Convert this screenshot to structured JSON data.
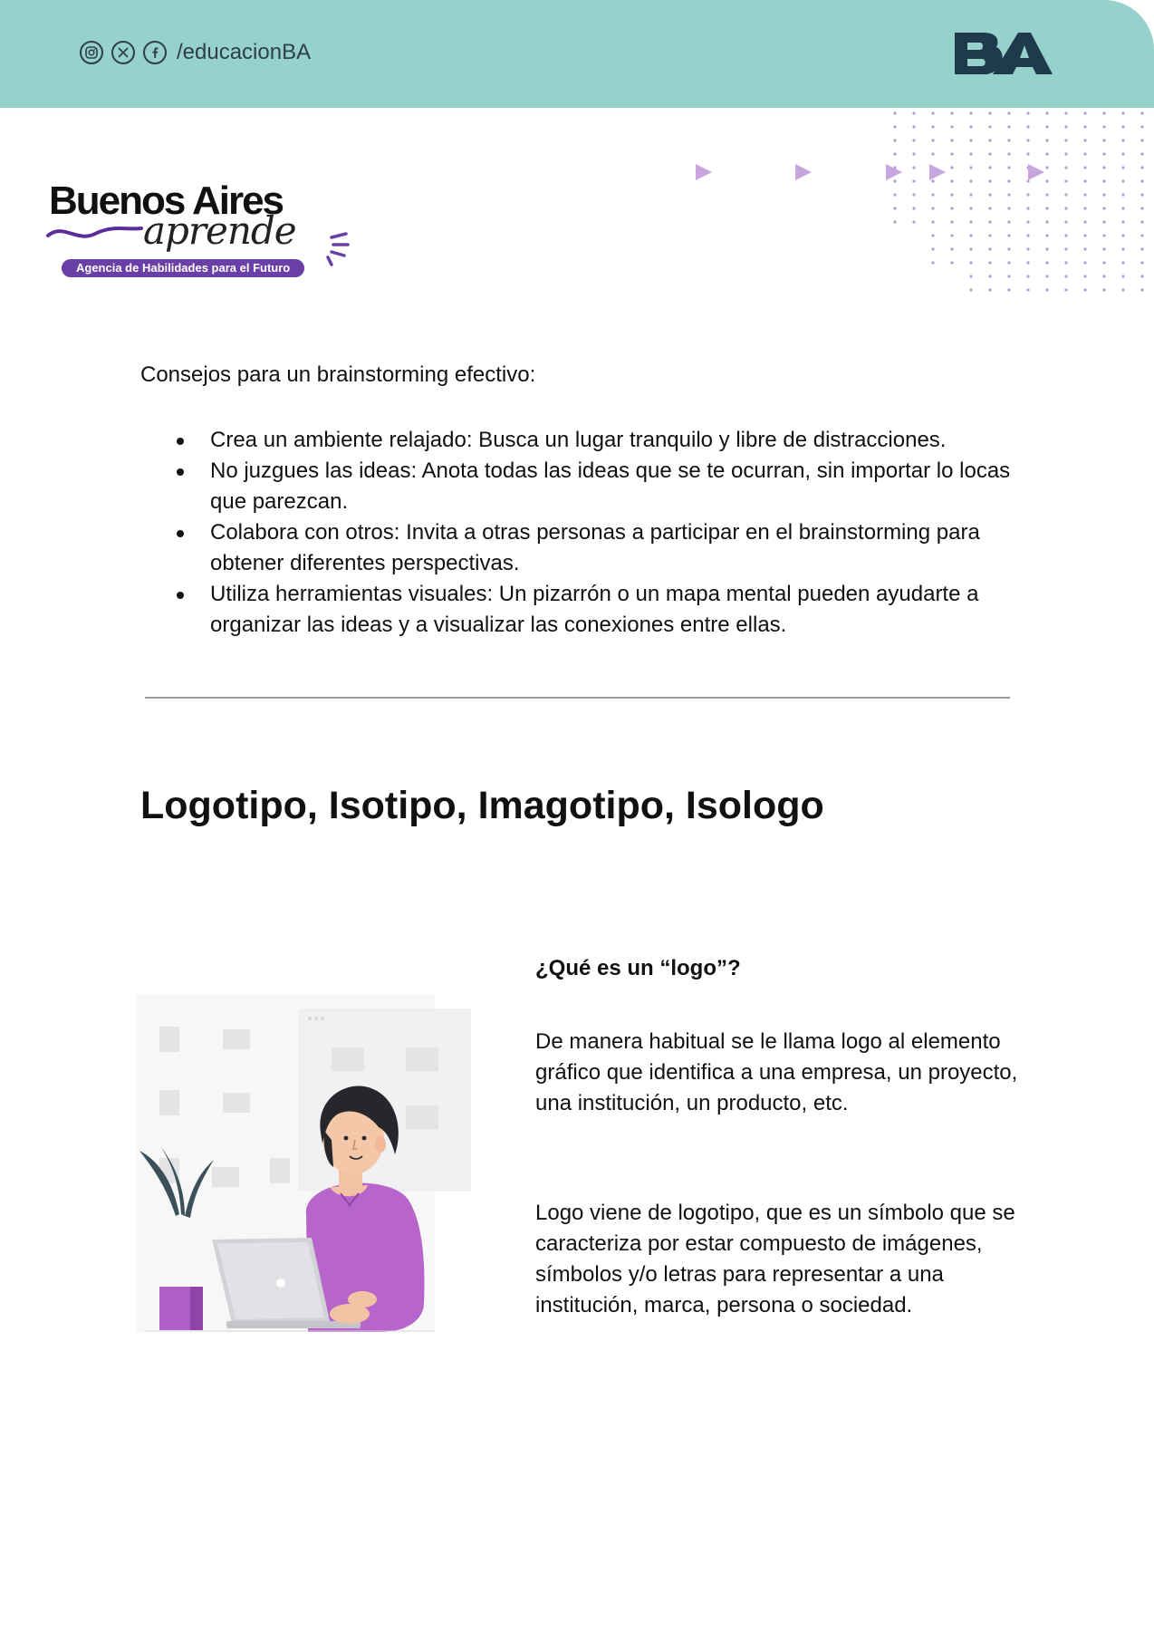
{
  "header": {
    "social_handle": "/educacionBA",
    "social_icons": [
      "instagram-icon",
      "x-icon",
      "facebook-icon"
    ],
    "logo_text": "BA",
    "band_color": "#96d2cb"
  },
  "brand": {
    "title": "Buenos Aires",
    "script": "aprende",
    "tagline": "Agencia de Habilidades para el Futuro",
    "accent_color": "#6a3fa6"
  },
  "tips": {
    "heading": "Consejos para un brainstorming efectivo:",
    "items": [
      "Crea un ambiente relajado: Busca un lugar tranquilo y libre de distracciones.",
      "No juzgues las ideas: Anota todas las ideas que se te ocurran, sin importar lo locas que parezcan.",
      "Colabora con otros: Invita a otras personas a participar en el brainstorming para obtener diferentes perspectivas.",
      "Utiliza herramientas visuales: Un pizarrón o un mapa mental pueden ayudarte a organizar las ideas y a visualizar las conexiones entre ellas."
    ]
  },
  "section": {
    "title": "Logotipo, Isotipo, Imagotipo, Isologo"
  },
  "logo_info": {
    "question": "¿Qué es un “logo”?",
    "paragraphs": [
      "De manera habitual se le llama logo al elemento gráfico que identifica a una empresa, un proyecto, una institución, un producto, etc.",
      "Logo viene de logotipo, que es un símbolo que se caracteriza por estar compuesto de imágenes, símbolos y/o letras para representar a una institución, marca, persona o sociedad."
    ]
  }
}
